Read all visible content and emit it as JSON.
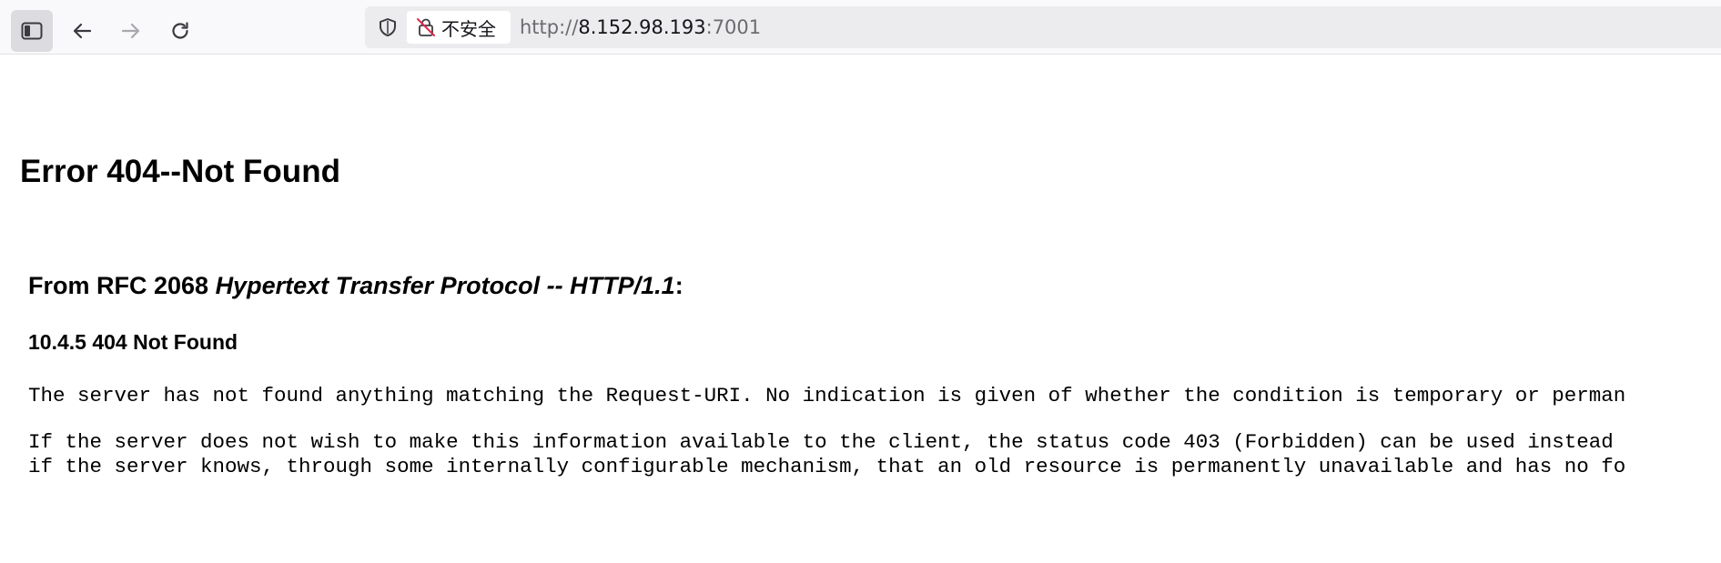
{
  "toolbar": {
    "buttons": [
      {
        "name": "sidebar-toggle",
        "icon": "sidebar-icon"
      },
      {
        "name": "back",
        "icon": "arrow-left-icon"
      },
      {
        "name": "forward",
        "icon": "arrow-right-icon"
      },
      {
        "name": "reload",
        "icon": "reload-icon"
      }
    ],
    "security_label": "不安全",
    "url": {
      "scheme": "http://",
      "host": "8.152.98.193",
      "port": ":7001"
    }
  },
  "page": {
    "title": "Error 404--Not Found",
    "rfc_heading_prefix": "From RFC 2068 ",
    "rfc_heading_italic": "Hypertext Transfer Protocol -- HTTP/1.1",
    "rfc_heading_suffix": ":",
    "section_heading": "10.4.5 404 Not Found",
    "paragraph1": "The server has not found anything matching the Request-URI. No indication is given of whether the condition is temporary or perman",
    "paragraph2_line1": "If the server does not wish to make this information available to the client, the status code 403 (Forbidden) can be used instead",
    "paragraph2_line2": "if the server knows, through some internally configurable mechanism, that an old resource is permanently unavailable and has no fo"
  },
  "colors": {
    "toolbar_bg": "#f9f9fb",
    "urlbar_bg": "#ececef",
    "active_button_bg": "#dcdce0",
    "url_dim": "#6b6b70",
    "insecure_red": "#e22850"
  }
}
